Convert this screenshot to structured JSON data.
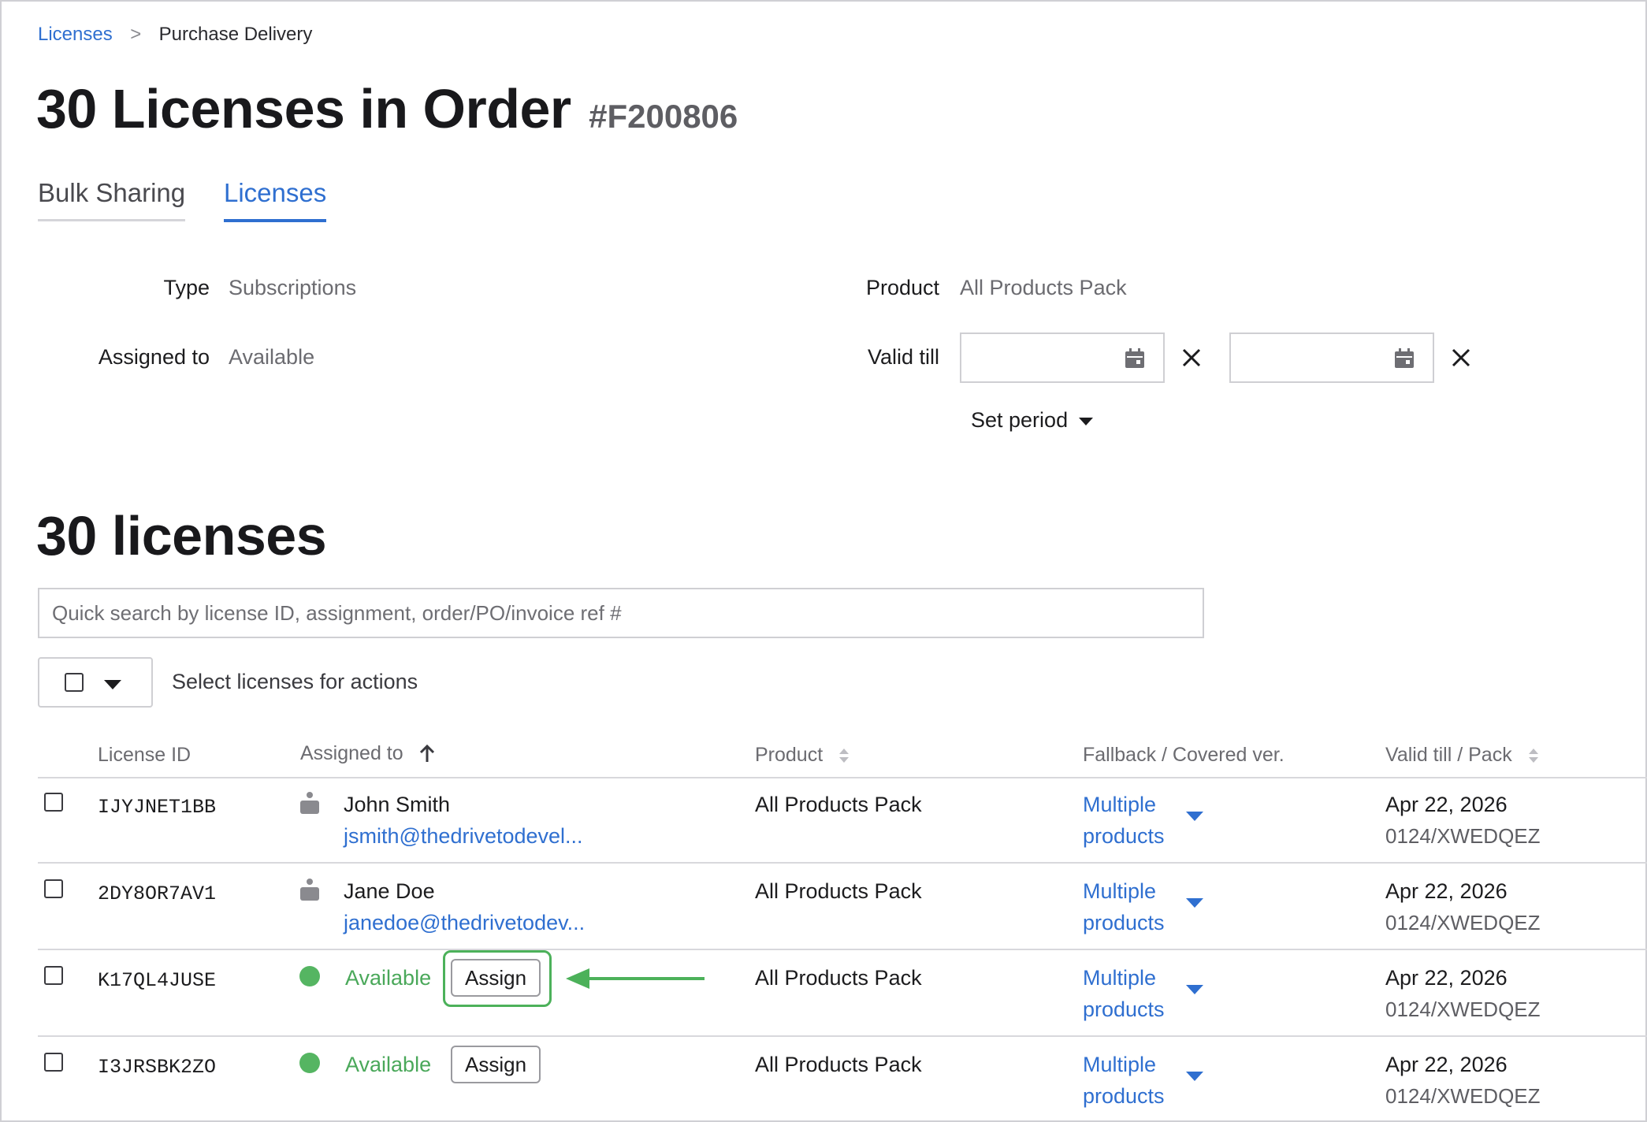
{
  "breadcrumb": {
    "parent": "Licenses",
    "separator": ">",
    "current": "Purchase Delivery"
  },
  "header": {
    "title": "30 Licenses in Order",
    "order_id": "#F200806"
  },
  "tabs": [
    {
      "label": "Bulk Sharing",
      "active": false
    },
    {
      "label": "Licenses",
      "active": true
    }
  ],
  "filters": {
    "type_label": "Type",
    "type_value": "Subscriptions",
    "assigned_label": "Assigned to",
    "assigned_value": "Available",
    "product_label": "Product",
    "product_value": "All Products Pack",
    "valid_till_label": "Valid till",
    "valid_from_value": "",
    "valid_to_value": "",
    "set_period_label": "Set period"
  },
  "list": {
    "title": "30 licenses",
    "search_placeholder": "Quick search by license ID, assignment, order/PO/invoice ref #",
    "bulk_hint": "Select licenses for actions"
  },
  "table": {
    "columns": {
      "license_id": "License ID",
      "assigned_to": "Assigned to",
      "product": "Product",
      "fallback": "Fallback / Covered ver.",
      "valid_till": "Valid till / Pack"
    },
    "assign_label": "Assign",
    "rows": [
      {
        "id": "IJYJNET1BB",
        "status": "assigned",
        "name": "John Smith",
        "email": "jsmith@thedrivetodevel...",
        "product": "All Products Pack",
        "fallback_line1": "Multiple",
        "fallback_line2": "products",
        "valid_till": "Apr 22, 2026",
        "pack": "0124/XWEDQEZ"
      },
      {
        "id": "2DY8OR7AV1",
        "status": "assigned",
        "name": "Jane Doe",
        "email": "janedoe@thedrivetodev...",
        "product": "All Products Pack",
        "fallback_line1": "Multiple",
        "fallback_line2": "products",
        "valid_till": "Apr 22, 2026",
        "pack": "0124/XWEDQEZ"
      },
      {
        "id": "K17QL4JUSE",
        "status": "available",
        "available_label": "Available",
        "product": "All Products Pack",
        "fallback_line1": "Multiple",
        "fallback_line2": "products",
        "valid_till": "Apr 22, 2026",
        "pack": "0124/XWEDQEZ",
        "highlighted": true
      },
      {
        "id": "I3JRSBK2ZO",
        "status": "available",
        "available_label": "Available",
        "product": "All Products Pack",
        "fallback_line1": "Multiple",
        "fallback_line2": "products",
        "valid_till": "Apr 22, 2026",
        "pack": "0124/XWEDQEZ"
      }
    ]
  },
  "colors": {
    "accent": "#2f6fd0",
    "available": "#4aa85a",
    "highlight": "#4cb15a"
  },
  "icons": [
    "calendar-icon",
    "close-icon",
    "caret-down-icon",
    "sort-up-icon",
    "sort-both-icon",
    "user-icon",
    "status-dot-icon",
    "arrow-left-icon"
  ]
}
